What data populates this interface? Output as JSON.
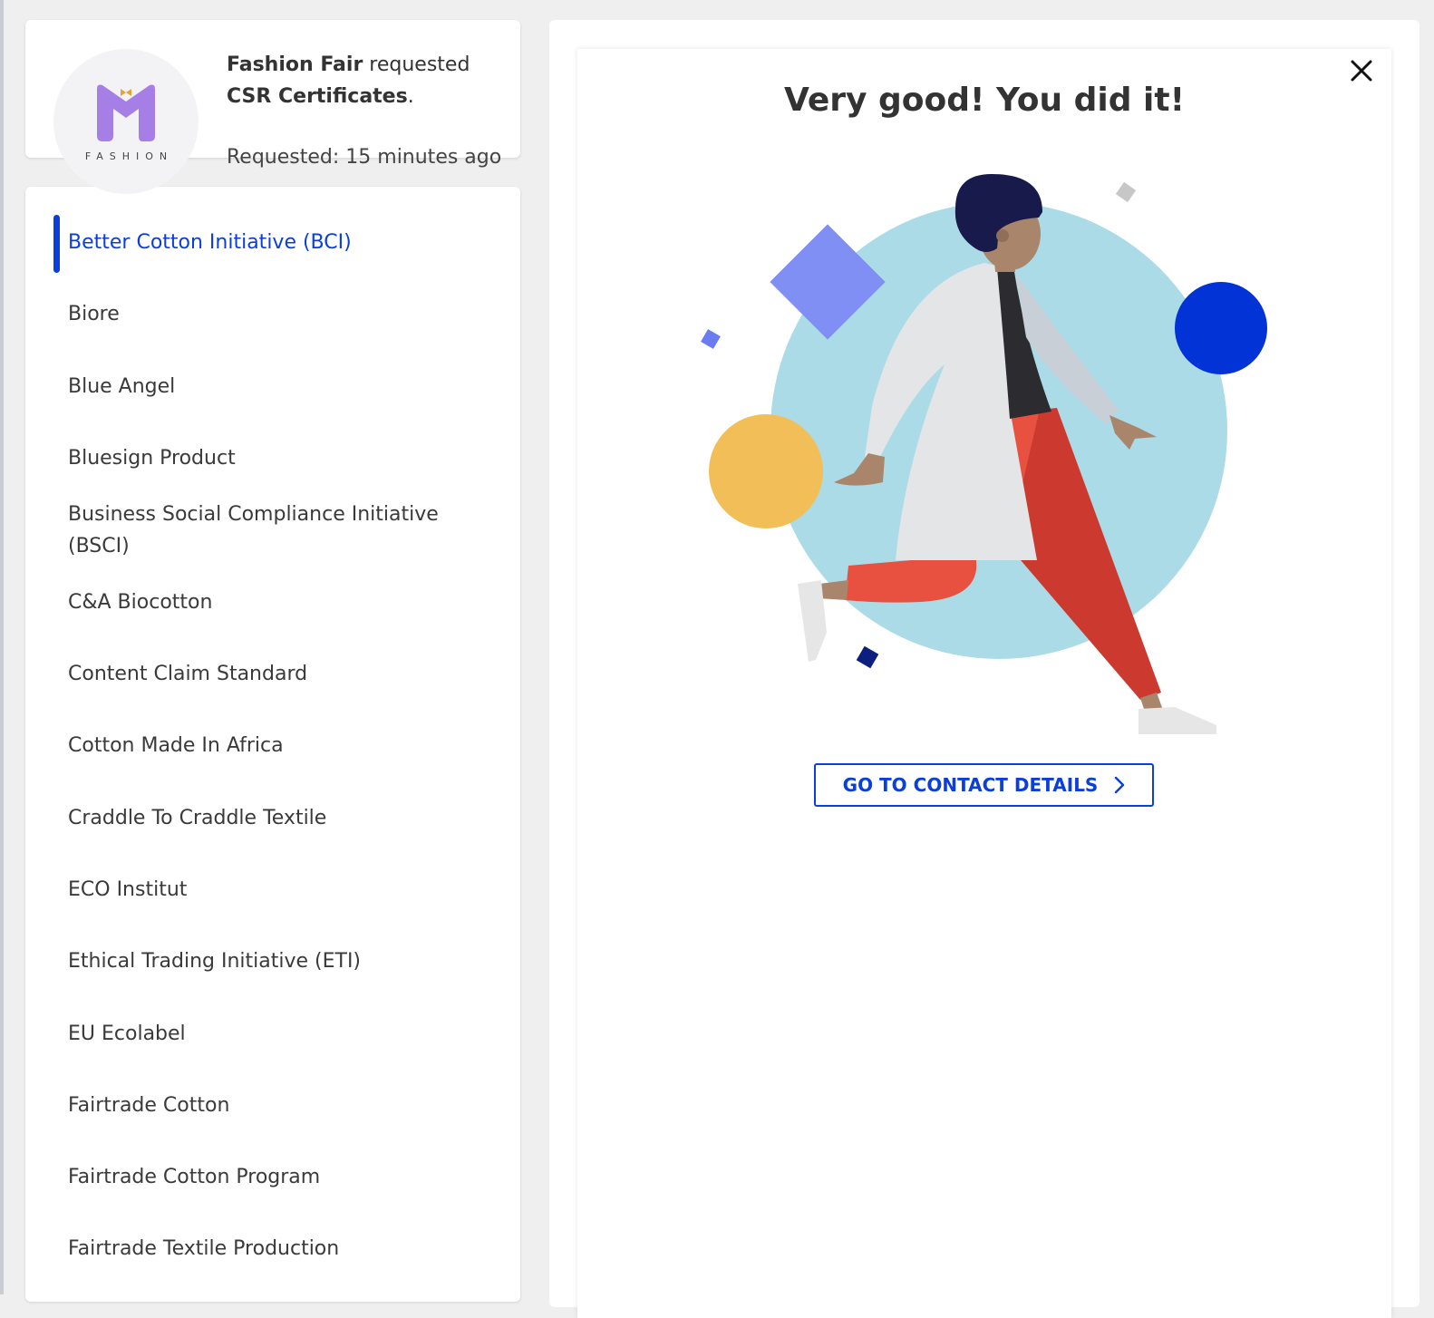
{
  "request": {
    "company": "Fashion Fair",
    "action": " requested",
    "item": "CSR Certificates",
    "suffix": ".",
    "time": "Requested: 15 minutes ago",
    "logo_word": "FASHION"
  },
  "certificates": {
    "active_index": 0,
    "items": [
      "Better Cotton Initiative (BCI)",
      "Biore",
      "Blue Angel",
      "Bluesign Product",
      "Business Social Compliance Initiative (BSCI)",
      "C&A Biocotton",
      "Content Claim Standard",
      "Cotton Made In Africa",
      "Craddle To Craddle Textile",
      "ECO Institut",
      "Ethical Trading Initiative (ETI)",
      "EU Ecolabel",
      "Fairtrade Cotton",
      "Fairtrade Cotton Program",
      "Fairtrade Textile Production"
    ]
  },
  "panel": {
    "headline": "Very good! You did it!",
    "cta_label": "GO TO CONTACT DETAILS",
    "close_icon": "close-icon",
    "cta_icon": "chevron-right-icon"
  },
  "colors": {
    "accent": "#0b3fd9",
    "text": "#333333",
    "background": "#efefef"
  }
}
